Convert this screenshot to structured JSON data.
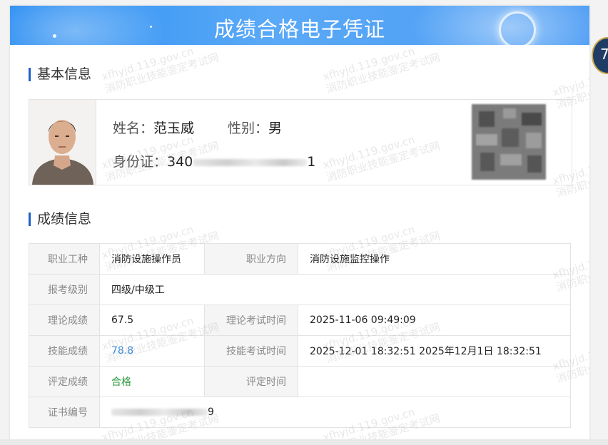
{
  "banner": {
    "title": "成绩合格电子凭证"
  },
  "basic": {
    "section_title": "基本信息",
    "name_label": "姓名：",
    "name_value": "范玉威",
    "gender_label": "性别：",
    "gender_value": "男",
    "id_label": "身份证：",
    "id_prefix": "340",
    "id_suffix": "1"
  },
  "scores": {
    "section_title": "成绩信息",
    "rows": [
      {
        "l1": "职业工种",
        "v1": "消防设施操作员",
        "l2": "职业方向",
        "v2": "消防设施监控操作"
      },
      {
        "l1": "报考级别",
        "v1": "四级/中级工"
      },
      {
        "l1": "理论成绩",
        "v1": "67.5",
        "l2": "理论考试时间",
        "v2": "2025-11-06 09:49:09"
      },
      {
        "l1": "技能成绩",
        "v1": "78.8",
        "l2": "技能考试时间",
        "v2": "2025-12-01 18:32:51  2025年12月1日 18:32:51"
      },
      {
        "l1": "评定成绩",
        "v1": "合格",
        "l2": "评定时间",
        "v2": ""
      },
      {
        "l1": "证书编号",
        "v1_suffix": "9"
      }
    ]
  },
  "watermark": {
    "line1": "xfhyjd.119.gov.cn",
    "line2": "消防职业技能鉴定考试网"
  },
  "side_badge": {
    "text": "7"
  },
  "colors": {
    "accent_blue": "#2b8ef2",
    "section_bar": "#1d5fc9",
    "skill_score": "#3b8ddb",
    "pass_green": "#2c9a3e"
  }
}
